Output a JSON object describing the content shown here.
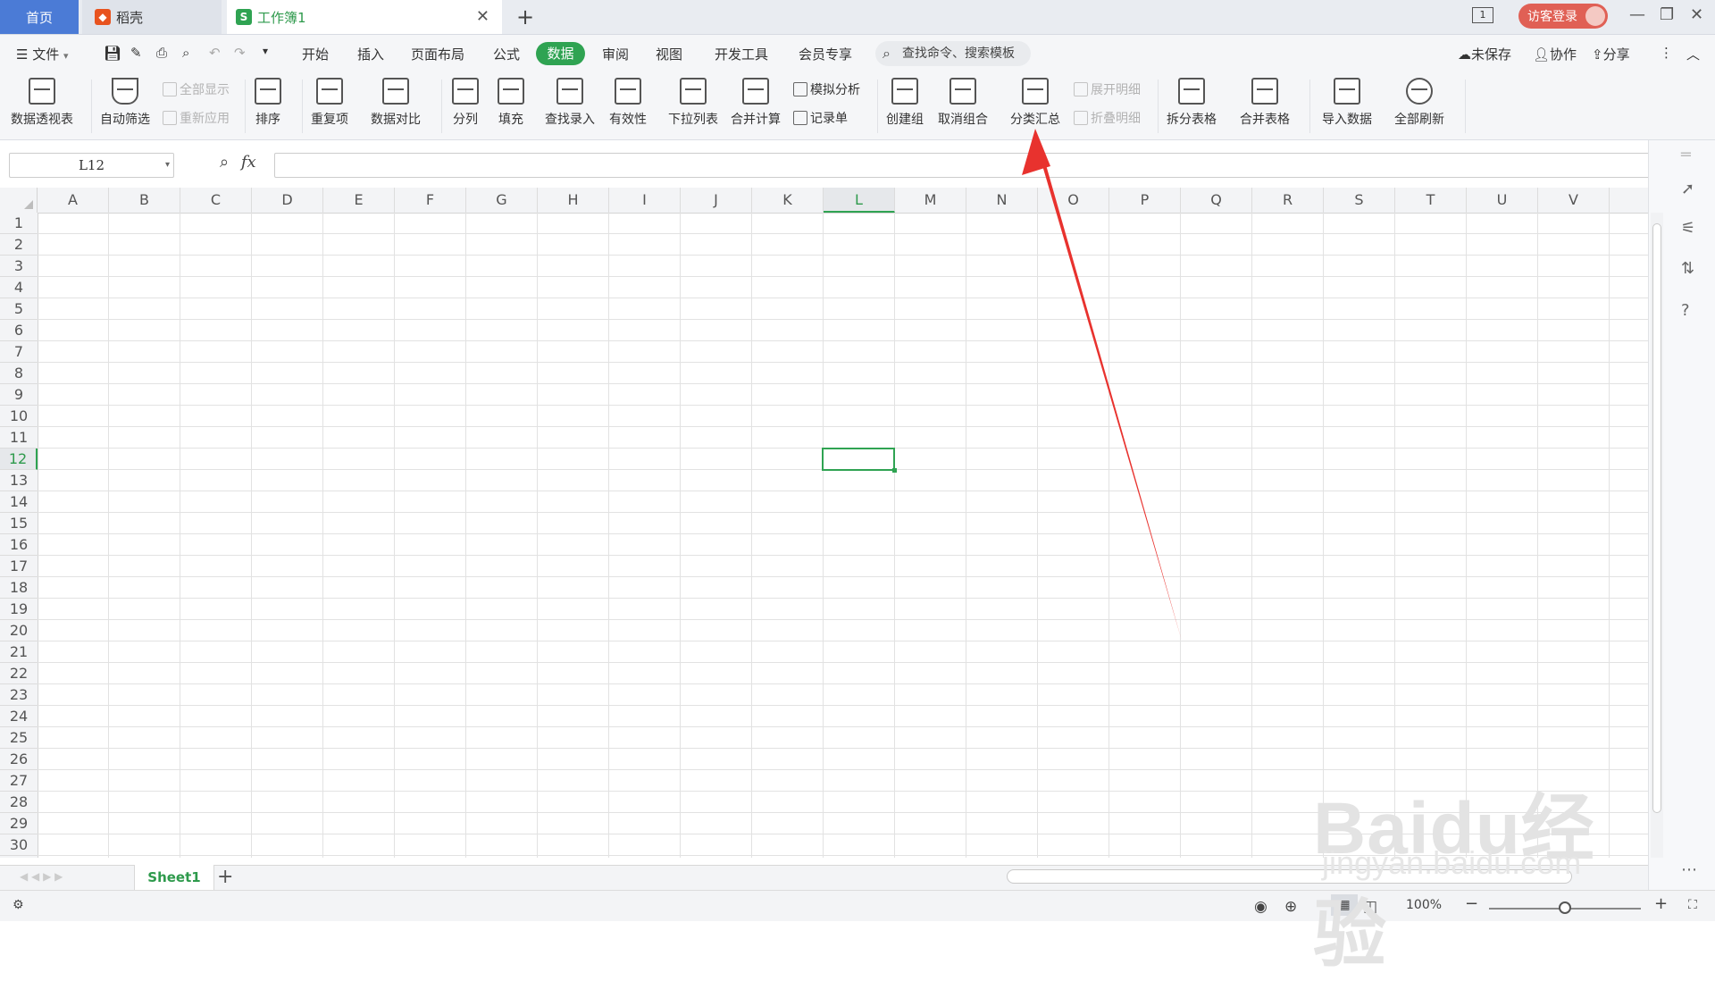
{
  "titlebar": {
    "tab_home": "首页",
    "tab_daoke": "稻壳",
    "tab_book": "工作簿1",
    "new_tab": "+",
    "badge": "1",
    "login": "访客登录"
  },
  "menubar": {
    "file": "文件",
    "items": [
      "开始",
      "插入",
      "页面布局",
      "公式",
      "数据",
      "审阅",
      "视图",
      "开发工具",
      "会员专享"
    ],
    "search_placeholder": "查找命令、搜索模板",
    "unsaved": "未保存",
    "collab": "协作",
    "share": "分享"
  },
  "ribbon": {
    "pivot": "数据透视表",
    "autofilter": "自动筛选",
    "show_all": "全部显示",
    "reapply": "重新应用",
    "sort": "排序",
    "duplicates": "重复项",
    "compare": "数据对比",
    "split_col": "分列",
    "fill": "填充",
    "lookup_entry": "查找录入",
    "validity": "有效性",
    "dropdown_list": "下拉列表",
    "consolidate": "合并计算",
    "whatif": "模拟分析",
    "record_form": "记录单",
    "create_group": "创建组",
    "ungroup": "取消组合",
    "subtotal": "分类汇总",
    "expand_detail": "展开明细",
    "collapse_detail": "折叠明细",
    "split_table": "拆分表格",
    "merge_table": "合并表格",
    "import_data": "导入数据",
    "refresh_all": "全部刷新"
  },
  "formulabar": {
    "cell_ref": "L12",
    "fx": "fx",
    "formula": ""
  },
  "grid": {
    "columns": [
      "A",
      "B",
      "C",
      "D",
      "E",
      "F",
      "G",
      "H",
      "I",
      "J",
      "K",
      "L",
      "M",
      "N",
      "O",
      "P",
      "Q",
      "R",
      "S",
      "T",
      "U",
      "V"
    ],
    "rows": [
      "1",
      "2",
      "3",
      "4",
      "5",
      "6",
      "7",
      "8",
      "9",
      "10",
      "11",
      "12",
      "13",
      "14",
      "15",
      "16",
      "17",
      "18",
      "19",
      "20",
      "21",
      "22",
      "23",
      "24",
      "25",
      "26",
      "27",
      "28",
      "29",
      "30"
    ],
    "selected_col": "L",
    "selected_row": "12"
  },
  "sheets": {
    "active": "Sheet1",
    "add": "+"
  },
  "status": {
    "zoom": "100%"
  },
  "watermark": {
    "brand": "Baidu经验",
    "url": "jingyan.baidu.com"
  },
  "colors": {
    "accent": "#2fa352",
    "home_tab": "#4b7bd6",
    "login": "#e06055",
    "arrow": "#e8322e"
  }
}
